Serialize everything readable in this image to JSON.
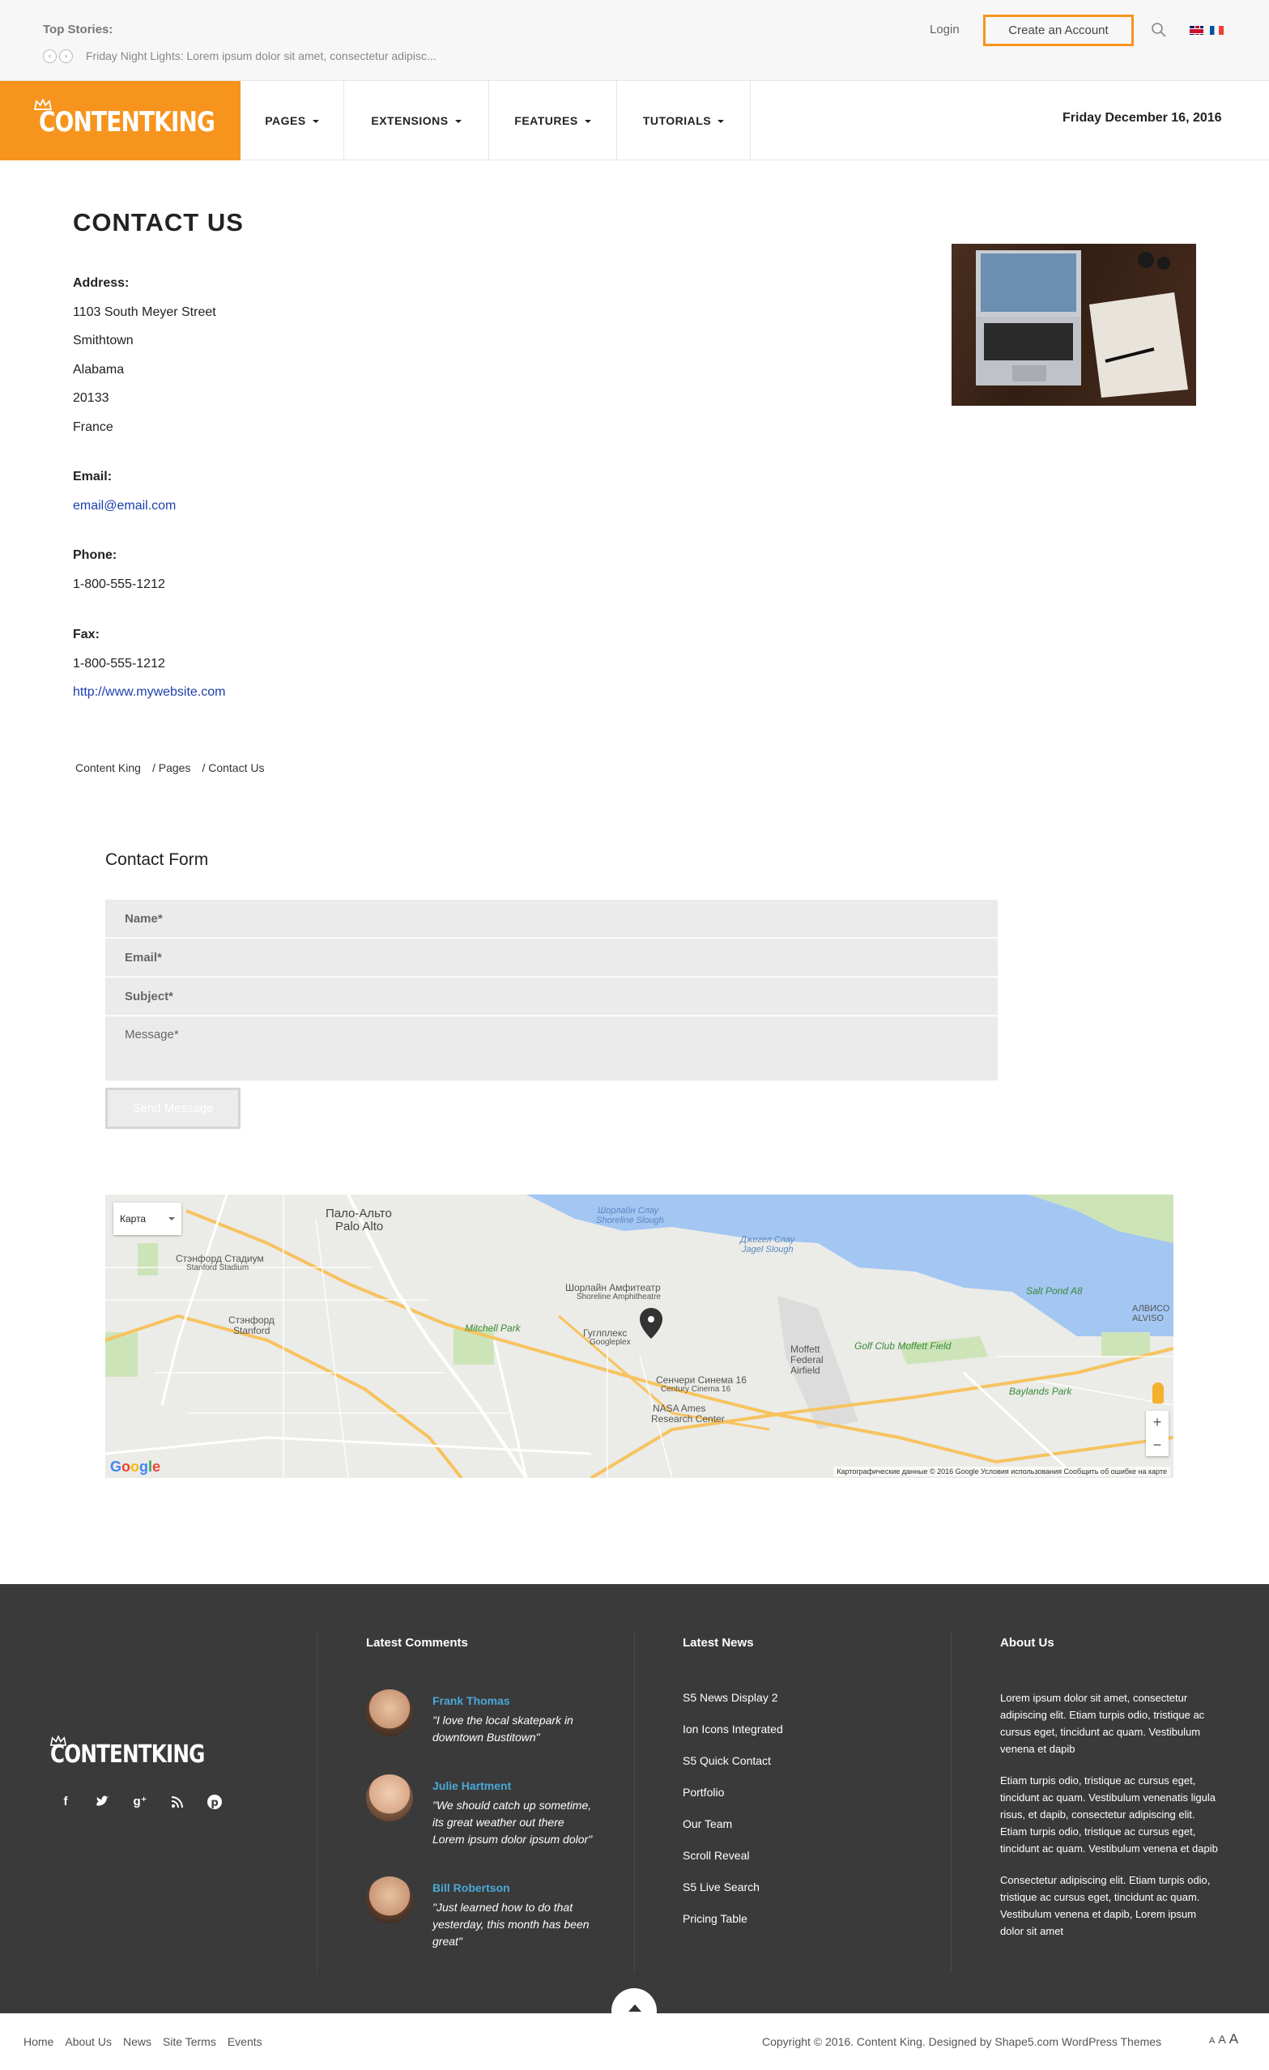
{
  "topbar": {
    "label": "Top Stories:",
    "ticker": "Friday Night Lights: Lorem ipsum dolor sit amet, consectetur adipisc...",
    "login": "Login",
    "create_account": "Create an Account"
  },
  "brand": {
    "logo": "CONTENTKING",
    "color": "#f7941d"
  },
  "nav": {
    "items": [
      "PAGES",
      "EXTENSIONS",
      "FEATURES",
      "TUTORIALS"
    ],
    "date": "Friday December 16, 2016"
  },
  "contact": {
    "title": "CONTACT US",
    "address_label": "Address:",
    "address": [
      "1103 South Meyer Street",
      "Smithtown",
      "Alabama",
      "20133",
      "France"
    ],
    "email_label": "Email:",
    "email": "email@email.com",
    "phone_label": "Phone:",
    "phone": "1-800-555-1212",
    "fax_label": "Fax:",
    "fax": "1-800-555-1212",
    "website": "http://www.mywebsite.com"
  },
  "breadcrumb": [
    "Content King",
    "/ Pages",
    "/ Contact Us"
  ],
  "form": {
    "title": "Contact Form",
    "name": "Name*",
    "email": "Email*",
    "subject": "Subject*",
    "message": "Message*",
    "send": "Send Message"
  },
  "map": {
    "type": "Карта",
    "labels": {
      "palo_alto": "Пало-Альто",
      "palo_alto_en": "Palo Alto",
      "stanford_stadium": "Стэнфорд Стадиум",
      "stanford_stadium_en": "Stanford Stadium",
      "stanford": "Стэнфорд",
      "stanford_en": "Stanford",
      "shoreline": "Шорлайн Амфитеатр",
      "shoreline_en": "Shoreline Amphitheatre",
      "googleplex": "Гуглплекс",
      "googleplex_en": "Googleplex",
      "cinema": "Сенчери Синема 16",
      "cinema_en": "Century Cinema 16",
      "nasa": "NASA Ames",
      "nasa_en": "Research Center",
      "mitchell": "Mitchell Park",
      "moffett": "Moffett",
      "moffett2": "Federal",
      "moffett3": "Airfield",
      "golf": "Golf Club Moffett Field",
      "baylands": "Baylands Park",
      "salt_pond": "Salt Pond A8",
      "alviso": "АЛВИСО",
      "alviso_en": "ALVISO",
      "shoreline_slough": "Шорлайн Слау",
      "shoreline_slough_en": "Shoreline Slough",
      "jagel": "Джегел Слау",
      "jagel_en": "Jagel Slough"
    },
    "footer": "Картографические данные © 2016 Google   Условия использования   Сообщить об ошибке на карте",
    "google": "Google",
    "zoom_in": "+",
    "zoom_out": "−"
  },
  "footer": {
    "logo": "CONTENTKING",
    "latest_comments": "Latest Comments",
    "latest_news": "Latest News",
    "about_us": "About Us",
    "comments": [
      {
        "name": "Frank Thomas",
        "text": "\"I love the local skatepark in downtown Bustitown\""
      },
      {
        "name": "Julie Hartment",
        "text": "\"We should catch up sometime, its great weather out there Lorem ipsum dolor ipsum dolor\""
      },
      {
        "name": "Bill Robertson",
        "text": "\"Just learned how to do that yesterday, this month has been great\""
      }
    ],
    "news": [
      "S5 News Display 2",
      "Ion Icons Integrated",
      "S5 Quick Contact",
      "Portfolio",
      "Our Team",
      "Scroll Reveal",
      "S5 Live Search",
      "Pricing Table"
    ],
    "about": [
      "Lorem ipsum dolor sit amet, consectetur adipiscing elit. Etiam turpis odio, tristique ac cursus eget, tincidunt ac quam. Vestibulum venena et dapib",
      "Etiam turpis odio, tristique ac cursus eget, tincidunt ac quam. Vestibulum venenatis ligula risus, et dapib, consectetur adipiscing elit. Etiam turpis odio, tristique ac cursus eget, tincidunt ac quam. Vestibulum venena et dapib",
      "Consectetur adipiscing elit. Etiam turpis odio, tristique ac cursus eget, tincidunt ac quam. Vestibulum venena et dapib, Lorem ipsum dolor sit amet"
    ]
  },
  "bottom": {
    "links": [
      "Home",
      "About Us",
      "News",
      "Site Terms",
      "Events"
    ],
    "copyright": "Copyright © 2016. Content King. Designed by Shape5.com WordPress Themes",
    "font_small": "A",
    "font_medium": "A",
    "font_large": "A"
  }
}
